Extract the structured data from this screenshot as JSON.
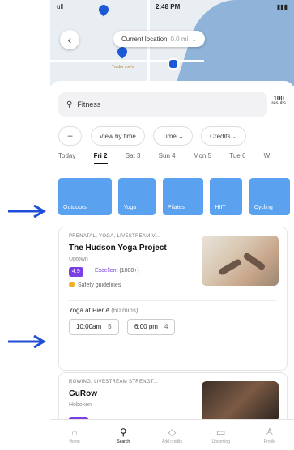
{
  "status": {
    "carrier": "ull",
    "time": "2:48 PM",
    "battery": ""
  },
  "map": {
    "location_label": "Current location",
    "distance": "0.0 mi",
    "poi": "Trader Joe's"
  },
  "search": {
    "query": "Fitness",
    "count": "100",
    "count_label": "results"
  },
  "filters": [
    "View by time",
    "Time",
    "Credits"
  ],
  "days": [
    "Today",
    "Fri 2",
    "Sat 3",
    "Sun 4",
    "Mon 5",
    "Tue 6",
    "W"
  ],
  "categories": [
    "Outdoors",
    "Yoga",
    "Pilates",
    "HIIT",
    "Cycling"
  ],
  "card1": {
    "category": "PRENATAL, YOGA, LIVESTREAM V...",
    "title": "The Hudson Yoga Project",
    "neighborhood": "Uptown",
    "rating": "4.9",
    "rating_label": "Excellent",
    "rating_count": "(1000+)",
    "safety": "Safety guidelines",
    "session_name": "Yoga at Pier A",
    "session_duration": "(60 mins)",
    "times": [
      {
        "time": "10:00am",
        "credits": "5"
      },
      {
        "time": "6:00 pm",
        "credits": "4"
      }
    ]
  },
  "card2": {
    "category": "ROWING, LIVESTREAM STRENGT...",
    "title": "GuRow",
    "neighborhood": "Hoboken"
  },
  "tabs": [
    "Home",
    "Search",
    "Add credits",
    "Upcoming",
    "Profile"
  ]
}
